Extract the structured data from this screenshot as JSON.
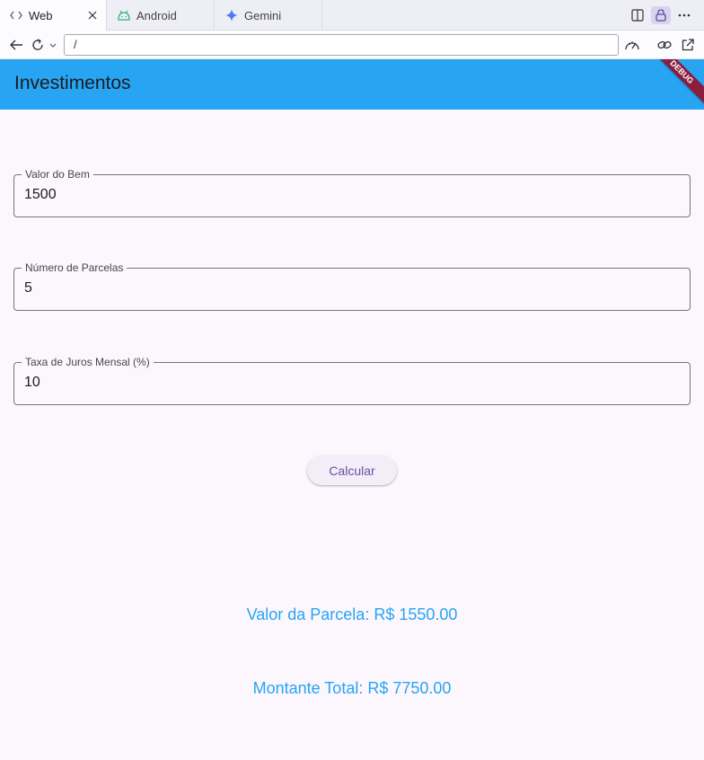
{
  "browser": {
    "tabs": [
      {
        "label": "Web",
        "icon": "code-icon"
      },
      {
        "label": "Android",
        "icon": "android-icon"
      },
      {
        "label": "Gemini",
        "icon": "gemini-sparkle-icon"
      }
    ],
    "url": "/"
  },
  "app": {
    "title": "Investimentos",
    "debug_banner": "DEBUG",
    "accent_color": "#27a5f3"
  },
  "form": {
    "valor_do_bem": {
      "label": "Valor do Bem",
      "value": "1500"
    },
    "numero_parcelas": {
      "label": "Número de Parcelas",
      "value": "5"
    },
    "taxa_juros": {
      "label": "Taxa de Juros Mensal (%)",
      "value": "10"
    },
    "calculate_label": "Calcular"
  },
  "results": {
    "parcela": "Valor da Parcela: R$ 1550.00",
    "montante": "Montante Total: R$ 7750.00"
  }
}
